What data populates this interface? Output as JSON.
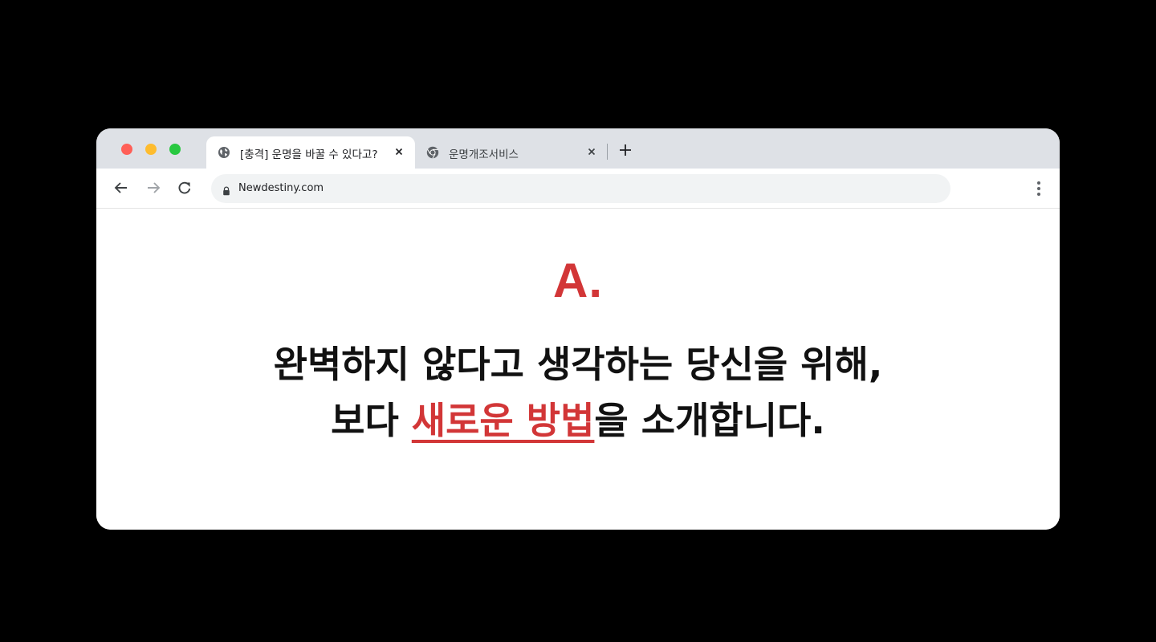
{
  "browser": {
    "tabs": [
      {
        "title": "[충격] 운명을 바꿀 수 있다고?",
        "icon": "globe-icon",
        "active": true
      },
      {
        "title": "운명개조서비스",
        "icon": "chrome-icon",
        "active": false
      }
    ],
    "url": "Newdestiny.com"
  },
  "page": {
    "logo": "A.",
    "headline_line1": "완벽하지 않다고 생각하는 당신을 위해,",
    "headline_line2_pre": "보다 ",
    "headline_line2_highlight": "새로운 방법",
    "headline_line2_post": "을 소개합니다."
  },
  "colors": {
    "accent": "#d23637",
    "tabbar": "#dee1e6",
    "omnibox": "#f1f3f4"
  }
}
